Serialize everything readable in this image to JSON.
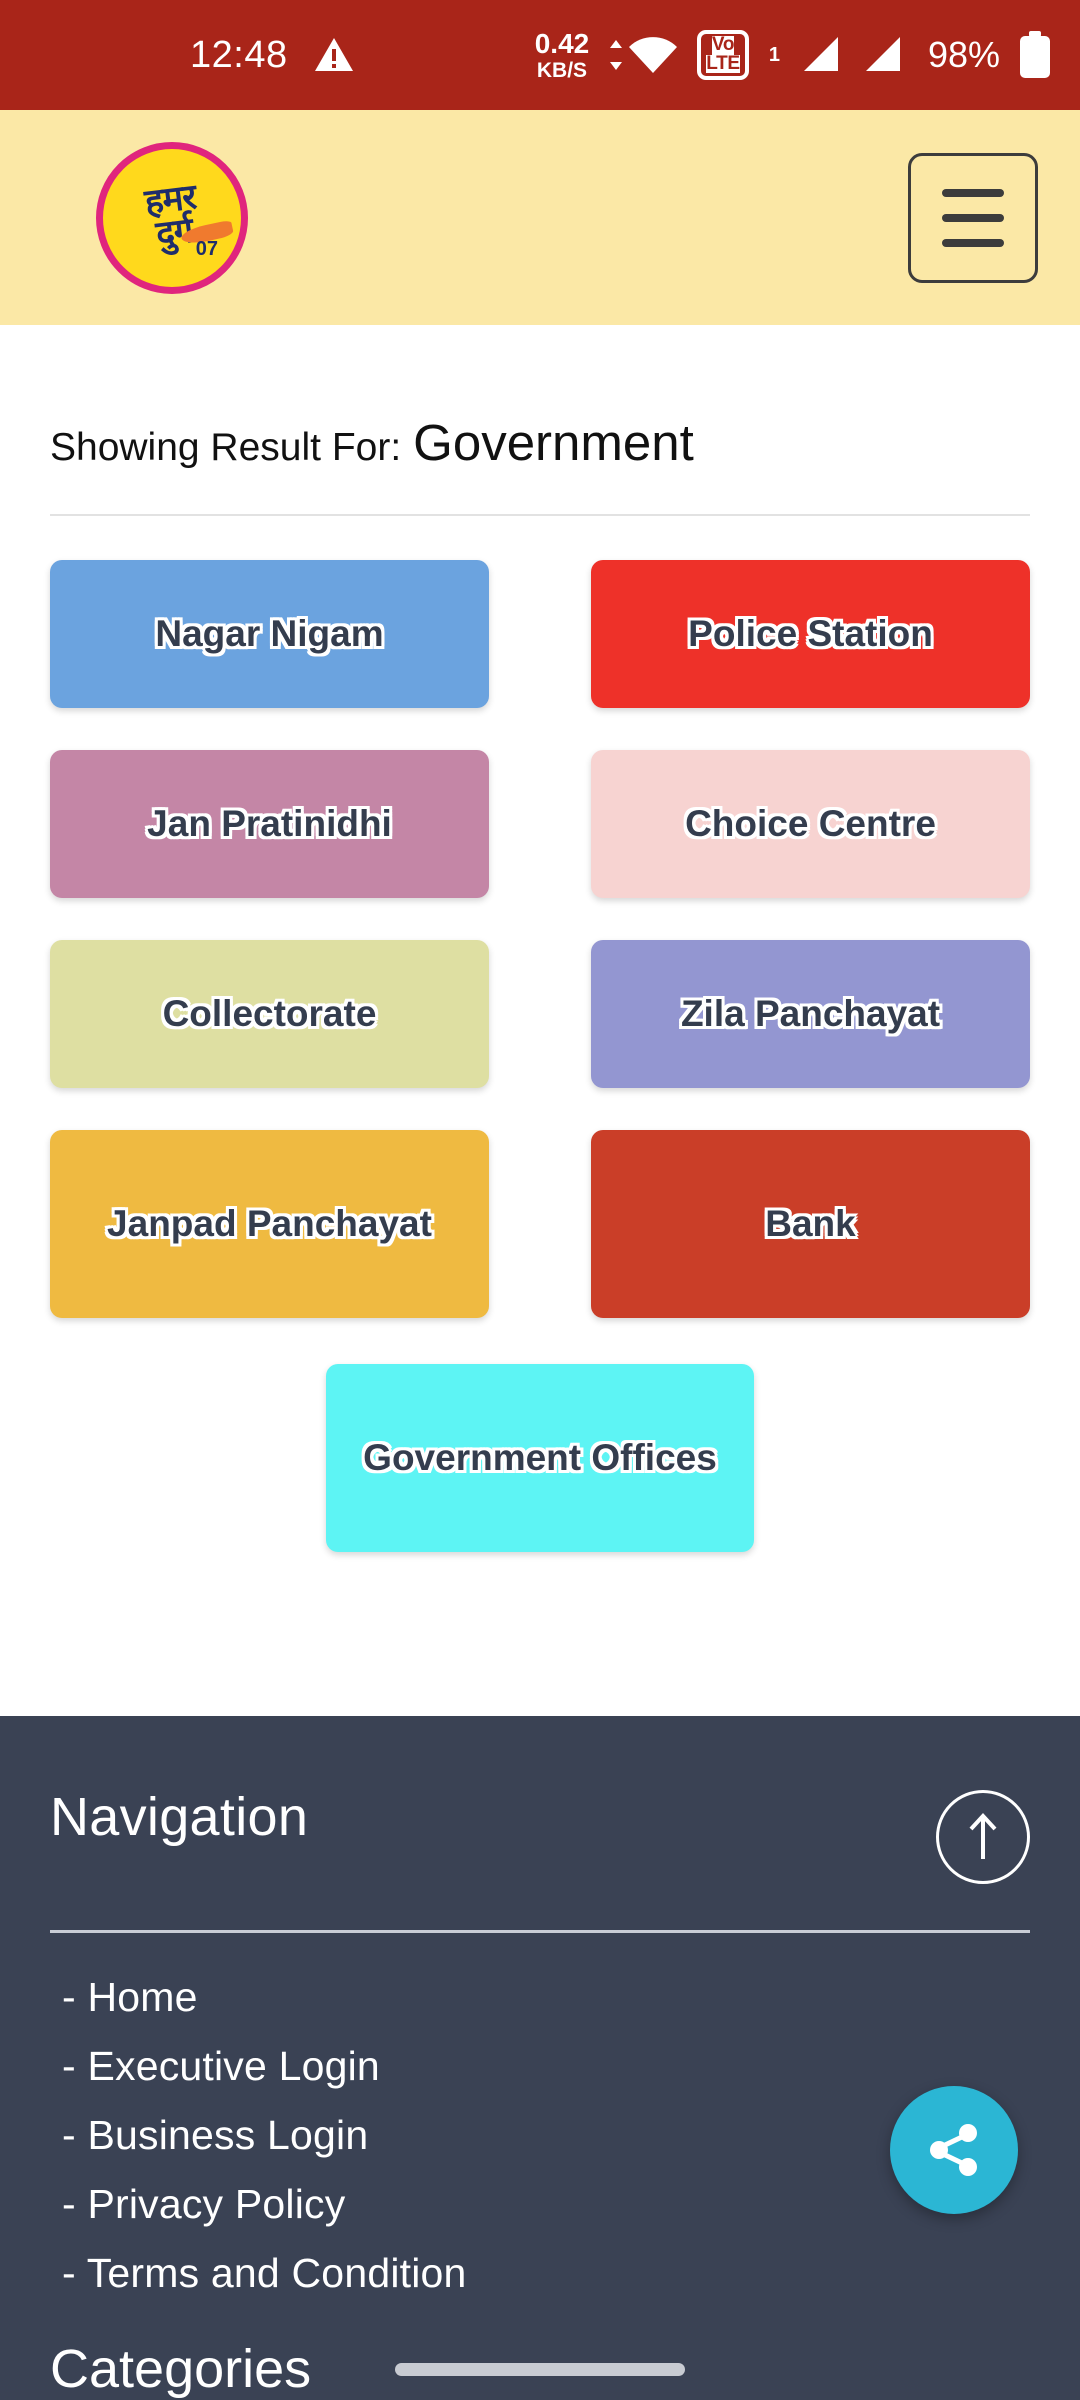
{
  "statusbar": {
    "time": "12:48",
    "warning_icon": "warning-triangle-icon",
    "net_speed_value": "0.42",
    "net_speed_unit": "KB/S",
    "wifi_icon": "wifi-icon",
    "volte_line1": "Vo",
    "volte_line2": "LTE",
    "volte_sim": "1",
    "signal_icon_1": "signal-bars-icon",
    "signal_icon_2": "signal-bars-icon",
    "battery_percent": "98%",
    "battery_icon": "battery-full-icon",
    "bg_color": "#A92519"
  },
  "header": {
    "logo_name": "hamar-durg-logo",
    "logo_text_line1": "हमर",
    "logo_text_line2": "दुर्ग",
    "logo_badge_number": "07",
    "menu_icon": "hamburger-menu-icon",
    "bg_color": "#FBE8A6"
  },
  "main": {
    "result_label": "Showing Result For:",
    "result_value": "Government",
    "tiles": [
      {
        "label": "Nagar Nigam",
        "color": "#6BA3DF"
      },
      {
        "label": "Police Station",
        "color": "#EE3129"
      },
      {
        "label": "Jan Pratinidhi",
        "color": "#C486A6"
      },
      {
        "label": "Choice Centre",
        "color": "#F7D3D1"
      },
      {
        "label": "Collectorate",
        "color": "#DEDFA2"
      },
      {
        "label": "Zila Panchayat",
        "color": "#9396D1"
      },
      {
        "label": "Janpad Panchayat",
        "color": "#EFBA41"
      },
      {
        "label": "Bank",
        "color": "#CA3E28"
      }
    ],
    "tile_last": {
      "label": "Government Offices",
      "color": "#5DF4F4"
    }
  },
  "footer": {
    "title": "Navigation",
    "scroll_top_icon": "arrow-up-icon",
    "nav_items": [
      "- Home",
      "- Executive Login",
      "- Business Login",
      "- Privacy Policy",
      "- Terms and Condition"
    ],
    "categories_title": "Categories",
    "bg_color": "#3A4254"
  },
  "fab": {
    "icon": "share-icon",
    "color": "#2BB6D4"
  }
}
